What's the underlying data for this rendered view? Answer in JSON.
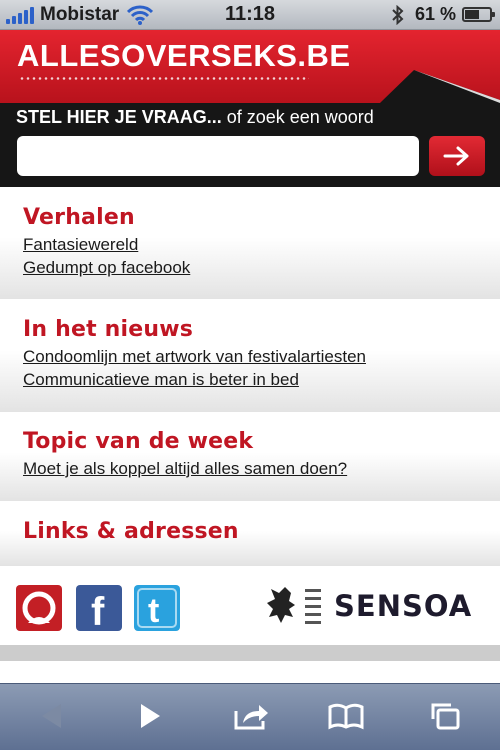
{
  "status_bar": {
    "carrier": "Mobistar",
    "time": "11:18",
    "battery_text": "61 %",
    "battery_level_percent": 61
  },
  "header": {
    "logo": "ALLESOVERSEKS.BE"
  },
  "search": {
    "prompt_strong": "STEL HIER JE VRAAG...",
    "prompt_rest": " of zoek een woord",
    "value": "",
    "placeholder": ""
  },
  "sections": {
    "verhalen": {
      "title": "Verhalen",
      "links": [
        "Fantasiewereld",
        "Gedumpt op facebook"
      ]
    },
    "nieuws": {
      "title": "In het nieuws",
      "links": [
        "Condoomlijn met artwork van festivalartiesten",
        "Communicatieve man is beter in bed"
      ]
    },
    "topic": {
      "title": "Topic van de week",
      "links": [
        "Moet je als koppel altijd alles samen doen?"
      ]
    },
    "links_adressen": {
      "title": "Links & adressen"
    }
  },
  "footer": {
    "facebook_letter": "f",
    "twitter_letter": "t",
    "sensoa": "SENSOA"
  },
  "colors": {
    "brand_red": "#c01623",
    "facebook_blue": "#3b5998",
    "twitter_blue": "#2aa2de"
  },
  "toolbar": {
    "icons": [
      "back-icon",
      "forward-icon",
      "share-icon",
      "bookmarks-icon",
      "tabs-icon"
    ]
  }
}
